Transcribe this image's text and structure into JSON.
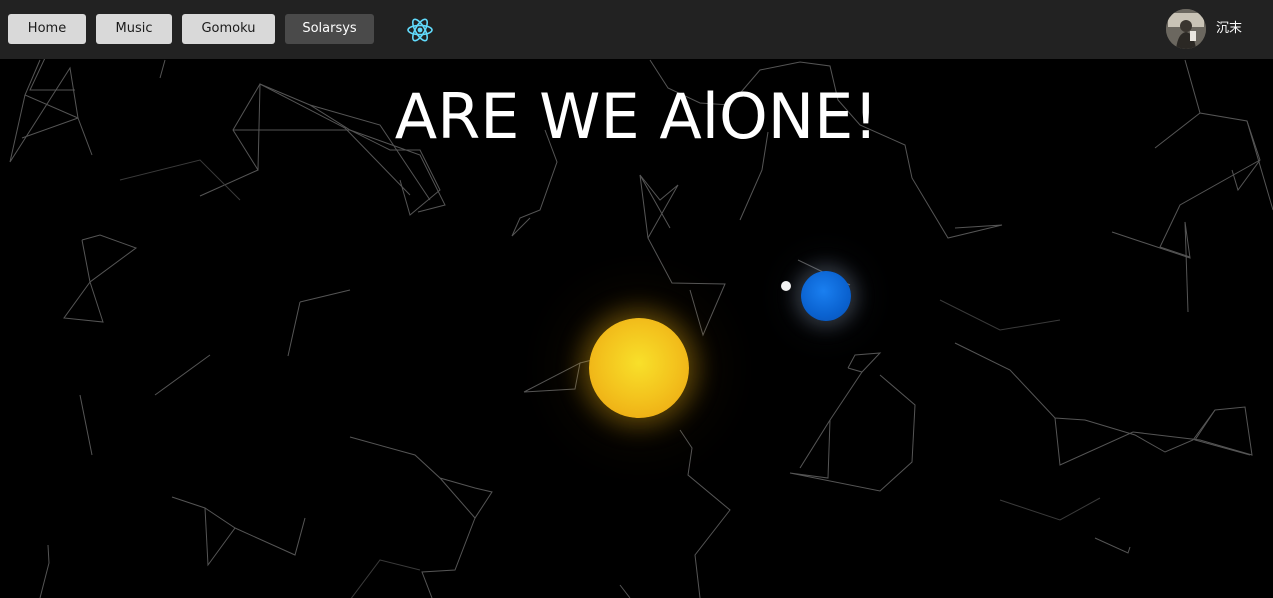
{
  "nav": {
    "items": [
      {
        "label": "Home"
      },
      {
        "label": "Music"
      },
      {
        "label": "Gomoku"
      },
      {
        "label": "Solarsys"
      }
    ],
    "active_item": "Solarsys",
    "logo_icon": "react-icon",
    "user": {
      "name": "沉末",
      "avatar_icon": "user-avatar"
    }
  },
  "main": {
    "headline": "ARE WE AlONE!",
    "bodies": [
      {
        "name": "sun",
        "color": "#f3c21d"
      },
      {
        "name": "earth",
        "color": "#0a62d0"
      },
      {
        "name": "moon",
        "color": "#f2f2f2"
      }
    ]
  },
  "colors": {
    "navbar_bg": "#222222",
    "page_bg": "#000000",
    "button_bg": "#d9d9d9",
    "button_active_bg": "#4a4a4a",
    "react_logo": "#61dafb",
    "constellation_lines": "#5a5a5a"
  }
}
